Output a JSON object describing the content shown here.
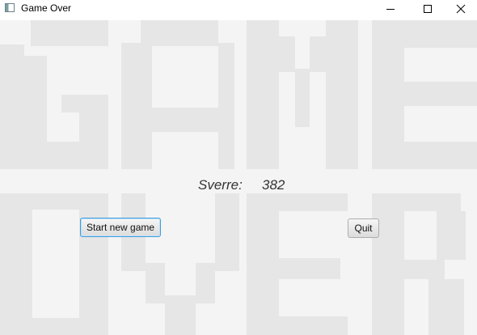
{
  "window": {
    "title": "Game Over",
    "icon": "app-window-icon",
    "controls": [
      "minimize-icon",
      "maximize-icon",
      "close-icon"
    ]
  },
  "background": {
    "watermark_text": "GAME OVER"
  },
  "score": {
    "player_name": "Sverre:",
    "value": "382"
  },
  "buttons": {
    "start_label": "Start new game",
    "quit_label": "Quit"
  },
  "colors": {
    "content_bg": "#f4f4f4",
    "watermark": "#e7e7e7",
    "focus_border": "#3f9ddc"
  }
}
